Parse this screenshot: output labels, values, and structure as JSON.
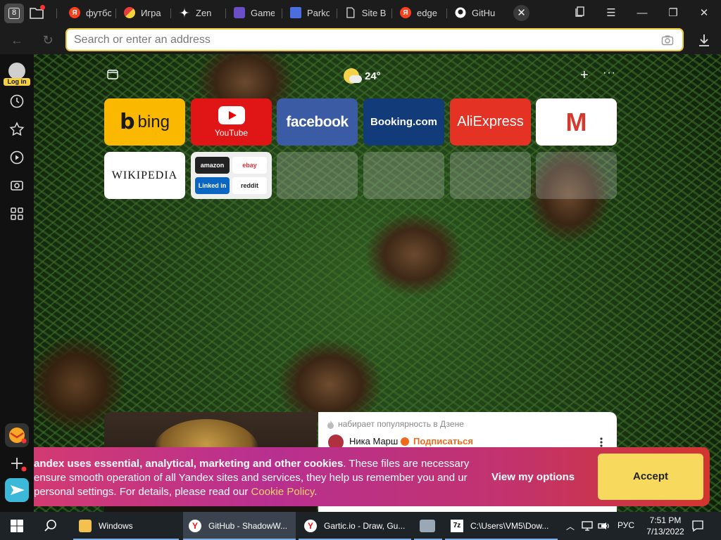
{
  "tabbar": {
    "tab_count": "8",
    "tabs": [
      {
        "label": "футбо",
        "icon": "yandex-icon",
        "color": "#fc3f1d"
      },
      {
        "label": "Игра",
        "icon": "gartic-icon",
        "color": "#e8d23c"
      },
      {
        "label": "Zen",
        "icon": "zen-icon",
        "color": "#111111"
      },
      {
        "label": "Game",
        "icon": "game-icon",
        "color": "#6b4fc8"
      },
      {
        "label": "Parko",
        "icon": "parkour-icon",
        "color": "#4a6de0"
      },
      {
        "label": "Site B",
        "icon": "document-icon",
        "color": "#cfcfcf"
      },
      {
        "label": "edge",
        "icon": "yandex-icon",
        "color": "#fc3f1d"
      },
      {
        "label": "GitHu",
        "icon": "github-icon",
        "color": "#ffffff"
      }
    ],
    "close_tab": "✕"
  },
  "addressbar": {
    "placeholder": "Search or enter an address"
  },
  "sidebar": {
    "login_label": "Log in"
  },
  "weather": {
    "temperature": "24°"
  },
  "tiles": {
    "bing": "bing",
    "youtube": "YouTube",
    "facebook": "facebook",
    "booking": "Booking.com",
    "aliexpress": "AliExpress",
    "gmail": "M",
    "wikipedia": "WIKIPEDIA",
    "folder": {
      "amazon": "amazon",
      "ebay": "ebay",
      "linkedin": "Linked in",
      "reddit": "reddit"
    }
  },
  "zen": {
    "trending": "набирает популярность в Дзене",
    "author": "Ника Марш",
    "subscribe": "Подписаться"
  },
  "cookie": {
    "bold": "andex uses essential, analytical, marketing and other cookies",
    "text": ". These files are necessary ensure smooth operation of all Yandex sites and services, they help us remember you and ur personal settings. For details, please read our ",
    "link": "Cookie Policy",
    "end": ".",
    "view_options": "View my options",
    "accept": "Accept"
  },
  "taskbar": {
    "items": [
      {
        "label": "Windows",
        "icon": "folder-icon"
      },
      {
        "label": "GitHub - ShadowW...",
        "icon": "yandex-browser-icon"
      },
      {
        "label": "Gartic.io - Draw, Gu...",
        "icon": "yandex-browser-icon"
      },
      {
        "label": "",
        "icon": "network-app-icon"
      },
      {
        "label": "C:\\Users\\VM5\\Dow...",
        "icon": "7zip-icon"
      }
    ],
    "language": "РУС",
    "time": "7:51 PM",
    "date": "7/13/2022"
  },
  "colors": {
    "accent_yellow": "#f0c93a",
    "cookie_pink": "#d23a71",
    "cookie_red": "#d3352f"
  }
}
